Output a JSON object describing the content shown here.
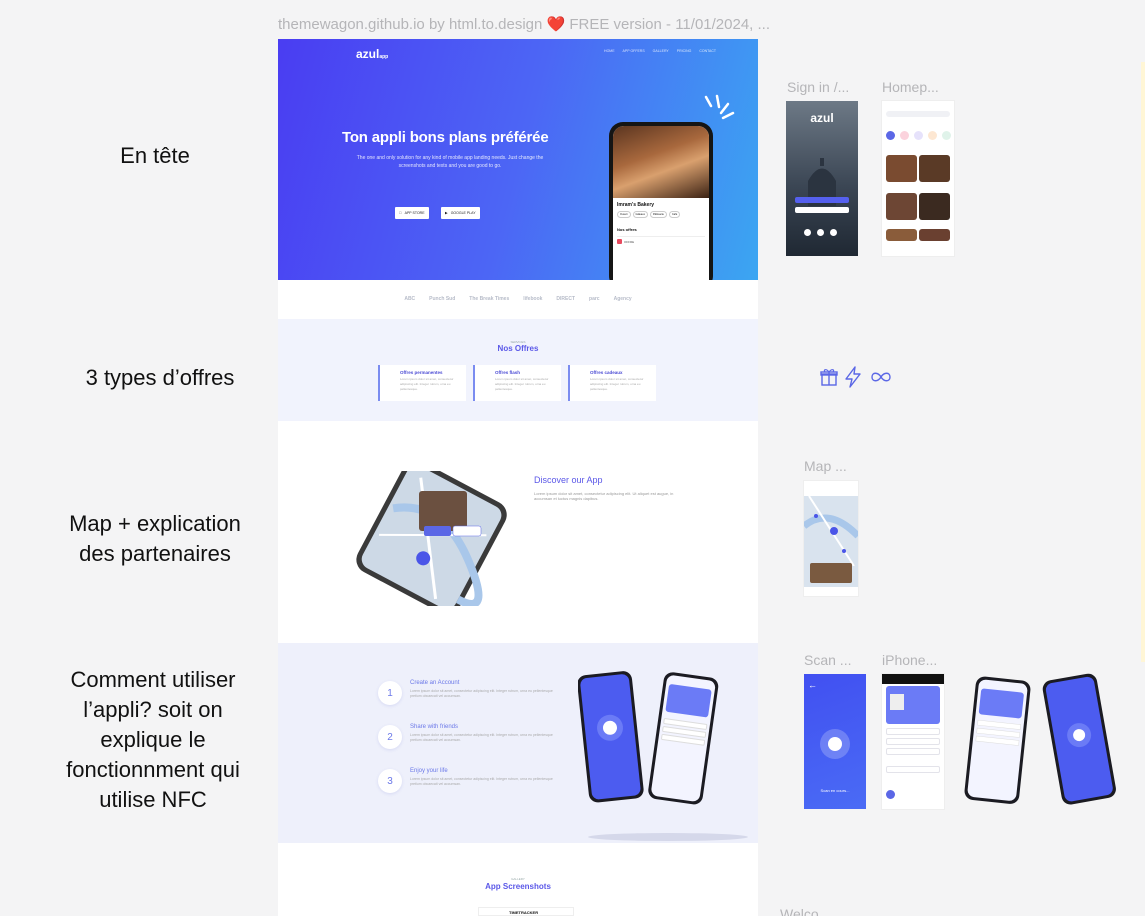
{
  "breadcrumb": "themewagon.github.io by html.to.design ❤️ FREE version - 11/01/2024, ...",
  "annotations": {
    "header": "En tête",
    "offers": "3 types d’offres",
    "map": "Map + explication\ndes partenaires",
    "howto": "Comment utiliser\nl’appli? soit on\nexplique le\nfonctionnment qui\nutilise NFC"
  },
  "frames": {
    "signin": "Sign in /...",
    "homepage": "Homep...",
    "map": "Map ...",
    "scan": "Scan ...",
    "iphone": "iPhone...",
    "welcome": "Welco..."
  },
  "site": {
    "logo": "azul",
    "logo_suffix": "app",
    "nav": [
      "HOME",
      "APP OFFERS",
      "GALLERY",
      "PRICING",
      "CONTACT"
    ],
    "hero_title": "Ton appli bons plans préférée",
    "hero_text": "The one and only solution for any kind of mobile app landing needs. Just change the screenshots and texts and you are good to go.",
    "app_store": "APP STORE",
    "google_play": "GOOGLE PLAY",
    "phone_shop": "Imram's Bakery",
    "phone_offers": "Nos offres",
    "partners": [
      "ABC",
      "Punch Sud",
      "The Break Times",
      "lifebook",
      "DIRECT",
      "parc",
      "Agency"
    ],
    "offers_kicker": "SERVICES",
    "offers_title": "Nos Offres",
    "offer_cards": [
      {
        "title": "Offres permanentes",
        "text": "Lorem ipsum dolor sit amet, consectetur adipiscing elit. Integer rutrum, urna eu pellentesque."
      },
      {
        "title": "Offres flash",
        "text": "Lorem ipsum dolor sit amet, consectetur adipiscing elit. Integer rutrum, urna eu pellentesque."
      },
      {
        "title": "Offres cadeaux",
        "text": "Lorem ipsum dolor sit amet, consectetur adipiscing elit. Integer rutrum, urna eu pellentesque."
      }
    ],
    "discover_title": "Discover our App",
    "discover_text": "Lorem ipsum dolor sit amet, consectetur adipiscing elit. Ut aliquet est augue, in accumsan et luctus magnis dapibus.",
    "steps": [
      {
        "num": "1",
        "title": "Create an Account",
        "text": "Lorem ipsum dolor sit amet, consectetur adipiscing elit. Integer rutrum, urna eu pellentesque pretium obcaecati vel accumsan."
      },
      {
        "num": "2",
        "title": "Share with friends",
        "text": "Lorem ipsum dolor sit amet, consectetur adipiscing elit. Integer rutrum, urna eu pellentesque pretium obcaecati vel accumsan."
      },
      {
        "num": "3",
        "title": "Enjoy your life",
        "text": "Lorem ipsum dolor sit amet, consectetur adipiscing elit. Integer rutrum, urna eu pellentesque pretium obcaecati vel accumsan."
      }
    ],
    "shots_kicker": "GALLERY",
    "shots_title": "App Screenshots",
    "shots_preview": "TIMETRACKER"
  },
  "icons": [
    "gift-icon",
    "lightning-icon",
    "infinity-icon"
  ],
  "colors": {
    "accent": "#5b58e8",
    "hero_start": "#4a3df2",
    "hero_end": "#3ba6f2",
    "icon": "#5b67e6"
  }
}
